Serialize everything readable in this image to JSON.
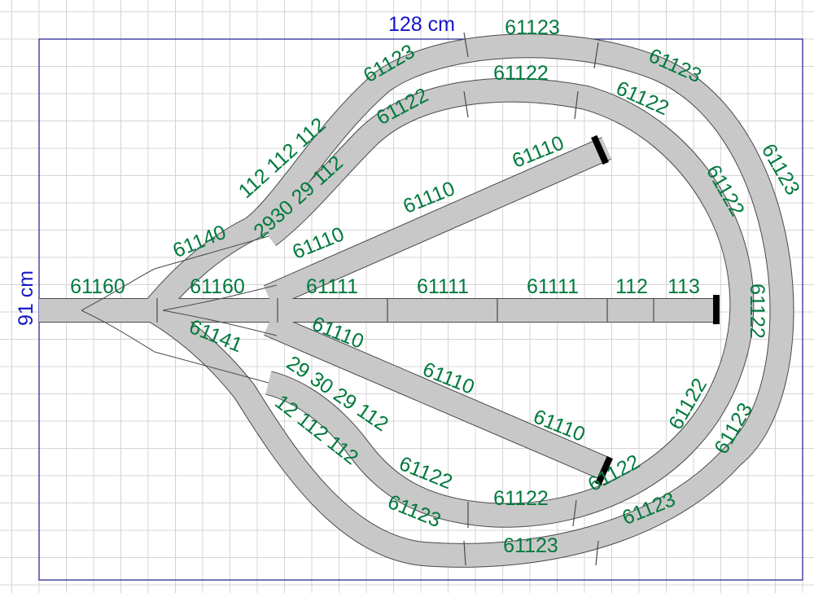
{
  "dimensions": {
    "width_label": "128 cm",
    "height_label": "91 cm"
  },
  "colors": {
    "background": "#ffffff",
    "grid": "#d4d4d4",
    "border": "#1a1a8c",
    "dimension_text": "#1616c8",
    "track_fill": "#c8c8c8",
    "track_outline": "#4a4a4a",
    "label_text": "#007a3d",
    "buffer_stop": "#000000"
  },
  "track_labels": [
    {
      "text": "61123"
    },
    {
      "text": "61123"
    },
    {
      "text": "61123"
    },
    {
      "text": "61123"
    },
    {
      "text": "61123"
    },
    {
      "text": "61123"
    },
    {
      "text": "61123"
    },
    {
      "text": "61123"
    },
    {
      "text": "61122"
    },
    {
      "text": "61122"
    },
    {
      "text": "61122"
    },
    {
      "text": "61122"
    },
    {
      "text": "61122"
    },
    {
      "text": "61122"
    },
    {
      "text": "61122"
    },
    {
      "text": "61122"
    },
    {
      "text": "61122"
    },
    {
      "text": "61110"
    },
    {
      "text": "61110"
    },
    {
      "text": "61110"
    },
    {
      "text": "61110"
    },
    {
      "text": "61110"
    },
    {
      "text": "61110"
    },
    {
      "text": "61111"
    },
    {
      "text": "61111"
    },
    {
      "text": "61111"
    },
    {
      "text": "112"
    },
    {
      "text": "113"
    },
    {
      "text": "61160"
    },
    {
      "text": "61160"
    },
    {
      "text": "61140"
    },
    {
      "text": "61141"
    },
    {
      "text": "112 112 112"
    },
    {
      "text": "2930 29 112"
    },
    {
      "text": "29 30 29 112"
    },
    {
      "text": "12 112 112"
    }
  ]
}
